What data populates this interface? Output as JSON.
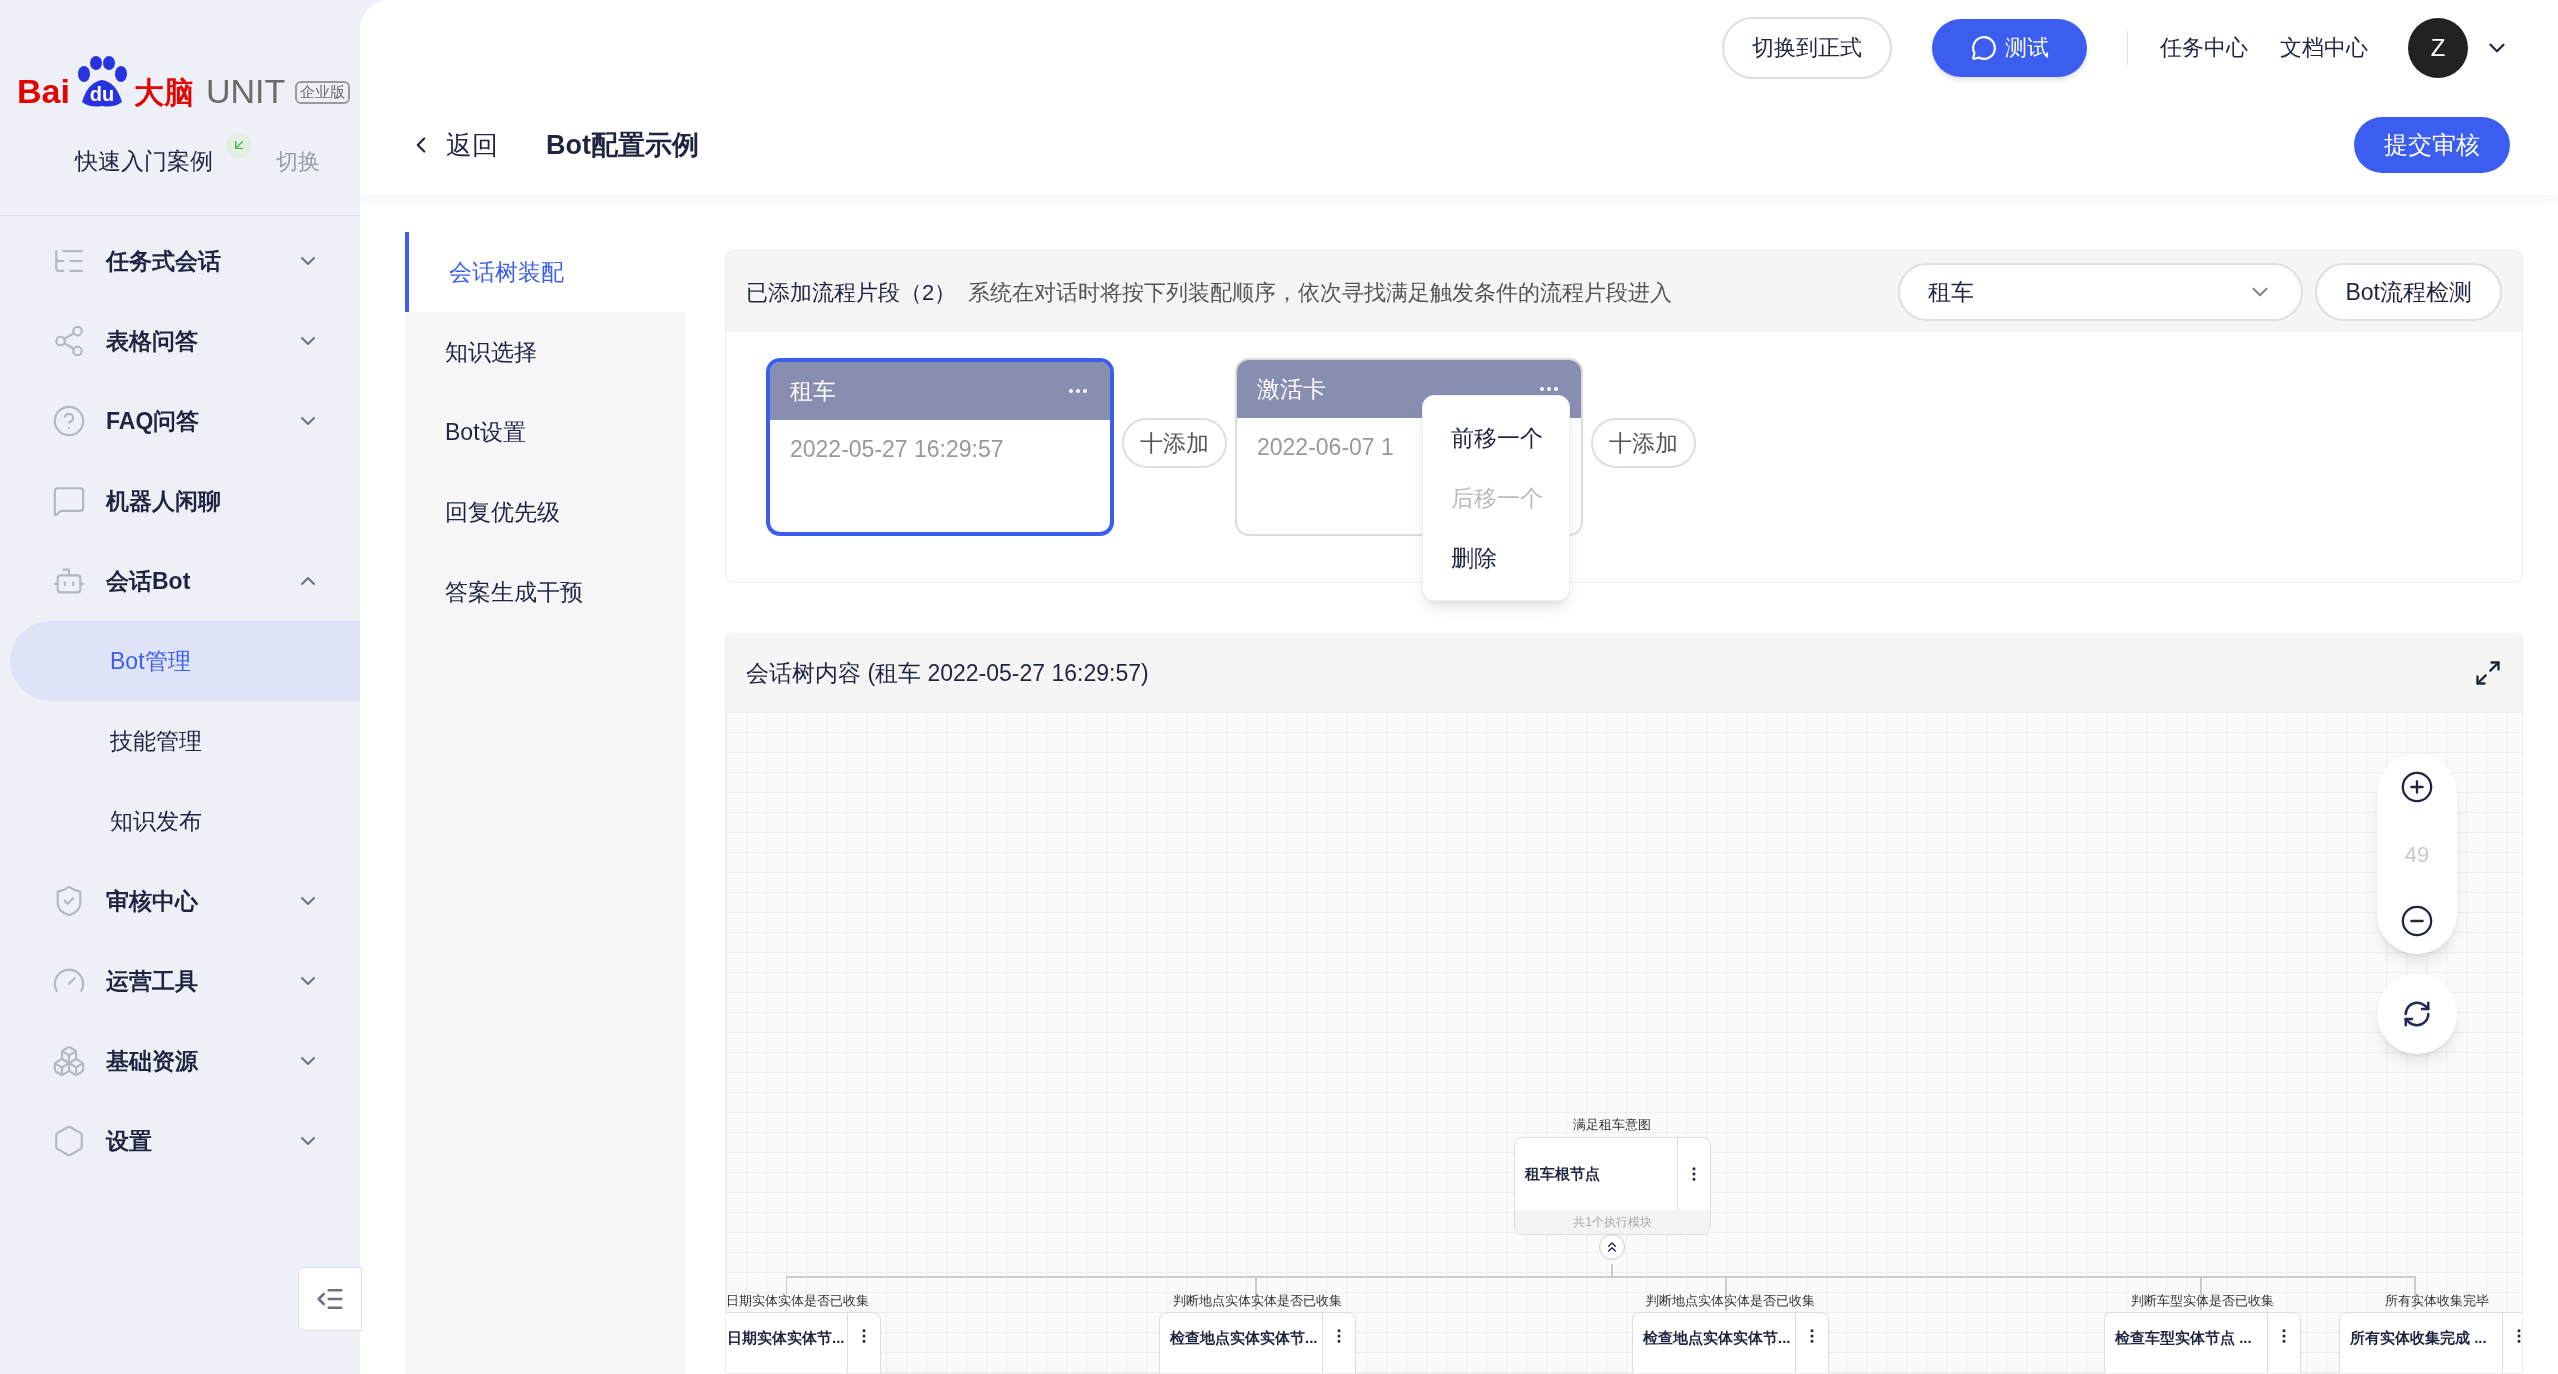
{
  "logo": {
    "brand_a": "Bai",
    "brand_b": "du",
    "brand_c": "大脑",
    "product": "UNIT",
    "edition": "企业版"
  },
  "workspace": {
    "name": "快速入门案例",
    "switch": "切换"
  },
  "sidebar": {
    "items": [
      {
        "label": "任务式会话",
        "kind": "group",
        "expanded": false
      },
      {
        "label": "表格问答",
        "kind": "group",
        "expanded": false
      },
      {
        "label": "FAQ问答",
        "kind": "group",
        "expanded": false
      },
      {
        "label": "机器人闲聊",
        "kind": "link"
      },
      {
        "label": "会话Bot",
        "kind": "group",
        "expanded": true,
        "children": [
          {
            "label": "Bot管理",
            "selected": true
          },
          {
            "label": "技能管理",
            "selected": false
          },
          {
            "label": "知识发布",
            "selected": false
          }
        ]
      },
      {
        "label": "审核中心",
        "kind": "group",
        "expanded": false
      },
      {
        "label": "运营工具",
        "kind": "group",
        "expanded": false
      },
      {
        "label": "基础资源",
        "kind": "group",
        "expanded": false
      },
      {
        "label": "设置",
        "kind": "group",
        "expanded": false
      }
    ]
  },
  "topbar": {
    "switch_button": "切换到正式",
    "test_button": "测试",
    "links": [
      "任务中心",
      "文档中心"
    ],
    "avatar": "Z"
  },
  "header": {
    "back": "返回",
    "title": "Bot配置示例",
    "submit": "提交审核"
  },
  "tabs": [
    {
      "label": "会话树装配",
      "selected": true
    },
    {
      "label": "知识选择",
      "selected": false
    },
    {
      "label": "Bot设置",
      "selected": false
    },
    {
      "label": "回复优先级",
      "selected": false
    },
    {
      "label": "答案生成干预",
      "selected": false
    }
  ],
  "flows": {
    "title": "已添加流程片段（2）",
    "hint": "系统在对话时将按下列装配顺序，依次寻找满足触发条件的流程片段进入",
    "select": "租车",
    "check_button": "Bot流程检测",
    "cards": [
      {
        "title": "租车",
        "time": "2022-05-27 16:29:57",
        "selected": true,
        "add_label": "十添加"
      },
      {
        "title": "激活卡",
        "time": "2022-06-07 1",
        "selected": false,
        "add_label": "十添加"
      }
    ],
    "menu": [
      {
        "label": "前移一个",
        "disabled": false
      },
      {
        "label": "后移一个",
        "disabled": true
      },
      {
        "label": "删除",
        "disabled": false
      }
    ]
  },
  "tree": {
    "title": "会话树内容 (租车 2022-05-27 16:29:57)",
    "zoom": "49",
    "root": {
      "condition": "满足租车意图",
      "title": "租车根节点",
      "footer": "共1个执行模块"
    },
    "children": [
      {
        "condition": "日期实体实体是否已收集",
        "title": "日期实体实体节..."
      },
      {
        "condition": "判断地点实体实体是否已收集",
        "title": "检查地点实体实体节..."
      },
      {
        "condition": "判断地点实体实体是否已收集",
        "title": "检查地点实体实体节..."
      },
      {
        "condition": "判断车型实体是否已收集",
        "title": "检查车型实体节点 ..."
      },
      {
        "condition": "所有实体收集完毕",
        "title": "所有实体收集完成 ..."
      }
    ]
  }
}
